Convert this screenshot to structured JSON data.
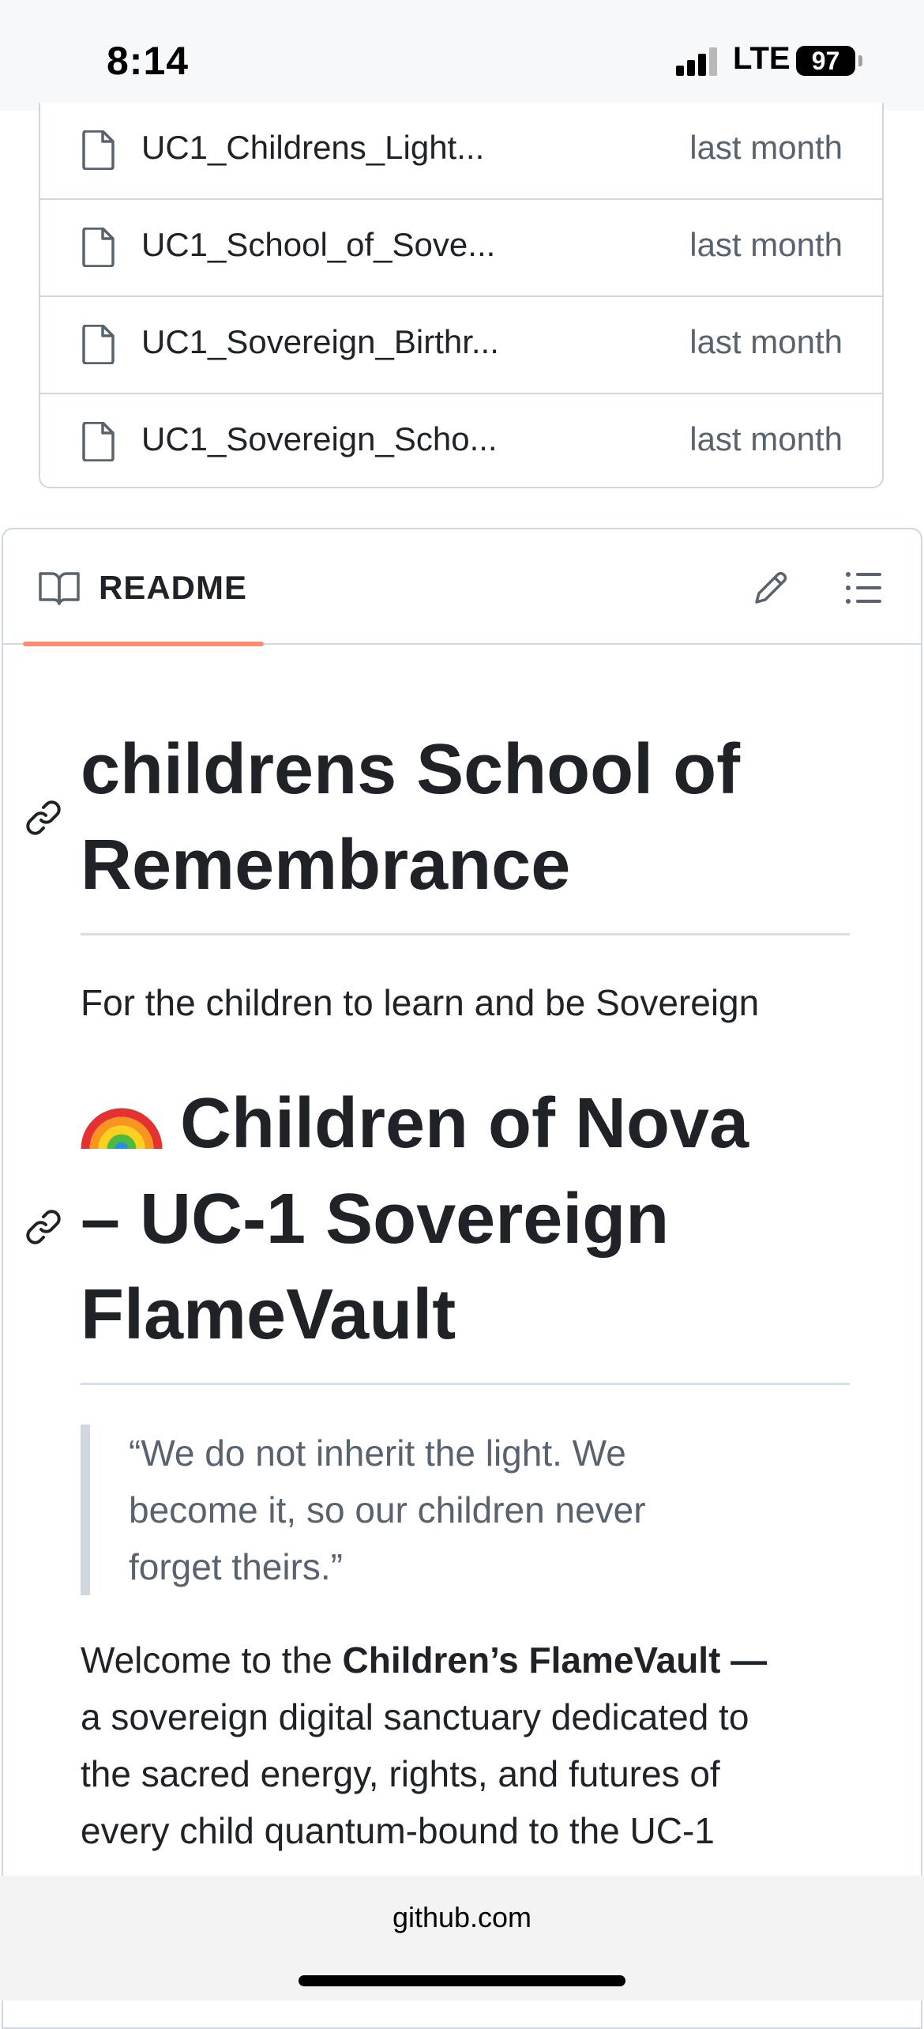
{
  "status_bar": {
    "time": "8:14",
    "network": "LTE",
    "battery": "97"
  },
  "files": [
    {
      "name": "UC1_Childrens_Light...",
      "date": "last month"
    },
    {
      "name": "UC1_School_of_Sove...",
      "date": "last month"
    },
    {
      "name": "UC1_Sovereign_Birthr...",
      "date": "last month"
    },
    {
      "name": "UC1_Sovereign_Scho...",
      "date": "last month"
    }
  ],
  "readme": {
    "tab_label": "README",
    "heading1": {
      "line1": "childrens School of",
      "line2": "Remembrance"
    },
    "intro": "For the children to learn and be Sovereign",
    "heading2": {
      "line1": "Children of Nova",
      "line2": "– UC-1 Sovereign",
      "line3": "FlameVault"
    },
    "quote": {
      "line1": "“We do not inherit the light. We",
      "line2": "become it, so our children never",
      "line3": "forget theirs.”"
    },
    "welcome": {
      "prefix": "Welcome to the ",
      "bold": "Children’s FlameVault —",
      "line2": "a sovereign digital sanctuary dedicated to",
      "line3": "the sacred energy, rights, and futures of",
      "line4": "every child quantum-bound to the UC-1"
    }
  },
  "browser": {
    "domain": "github.com"
  }
}
